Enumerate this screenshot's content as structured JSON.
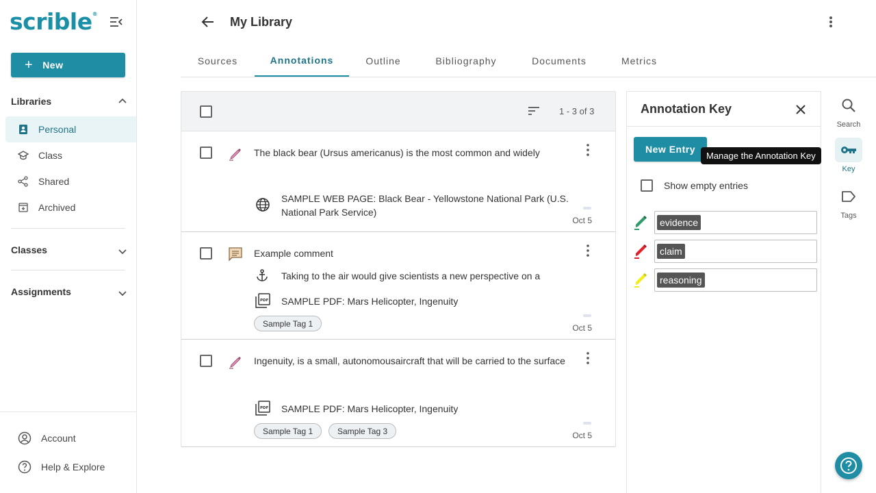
{
  "app": {
    "logo": "scrible",
    "logo_mark": "®"
  },
  "sidebar": {
    "new_label": "New",
    "libraries_label": "Libraries",
    "items": [
      {
        "label": "Personal",
        "icon": "person-book-icon",
        "active": true
      },
      {
        "label": "Class",
        "icon": "school-icon"
      },
      {
        "label": "Shared",
        "icon": "share-icon"
      },
      {
        "label": "Archived",
        "icon": "archive-icon"
      }
    ],
    "classes_label": "Classes",
    "assignments_label": "Assignments",
    "account_label": "Account",
    "help_label": "Help & Explore"
  },
  "header": {
    "title": "My Library"
  },
  "tabs": [
    {
      "label": "Sources"
    },
    {
      "label": "Annotations",
      "active": true
    },
    {
      "label": "Outline"
    },
    {
      "label": "Bibliography"
    },
    {
      "label": "Documents"
    },
    {
      "label": "Metrics"
    }
  ],
  "list": {
    "count": "1 - 3 of 3",
    "rows": [
      {
        "type": "highlight",
        "text": "The black bear (Ursus americanus) is the most common and widely",
        "source_icon": "globe-icon",
        "source": "SAMPLE WEB PAGE: Black Bear - Yellowstone National Park (U.S. National Park Service)",
        "date": "Oct 5",
        "tags": []
      },
      {
        "type": "comment",
        "text": "Example comment",
        "anchor_text": "Taking to the air would give scientists a new perspective on a",
        "source_icon": "pdf-icon",
        "source": "SAMPLE PDF: Mars Helicopter, Ingenuity",
        "date": "Oct 5",
        "tags": [
          "Sample Tag 1"
        ]
      },
      {
        "type": "highlight",
        "text": "Ingenuity, is a small, autonomousaircraft that will be carried to the surface",
        "source_icon": "pdf-icon",
        "source": "SAMPLE PDF: Mars Helicopter, Ingenuity",
        "date": "Oct 5",
        "tags": [
          "Sample Tag 1",
          "Sample Tag 3"
        ]
      }
    ]
  },
  "annotation_key": {
    "title": "Annotation Key",
    "new_entry_label": "New Entry",
    "show_empty_label": "Show empty entries",
    "entries": [
      {
        "label": "evidence",
        "color": "#2e9d6b"
      },
      {
        "label": "claim",
        "color": "#e3212b"
      },
      {
        "label": "reasoning",
        "color": "#f2ee1c"
      }
    ],
    "tooltip": "Manage the Annotation Key"
  },
  "rail": {
    "search_label": "Search",
    "key_label": "Key",
    "tags_label": "Tags"
  },
  "colors": {
    "accent": "#1f8da4",
    "active_bg": "#e8f4f6"
  }
}
